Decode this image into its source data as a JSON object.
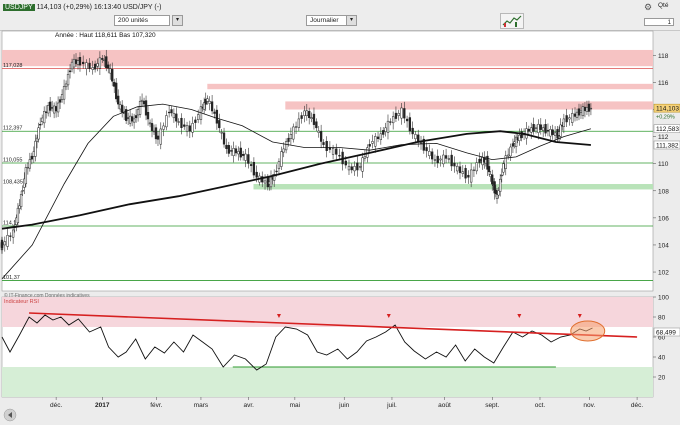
{
  "header": {
    "symbol_badge": "USDJPY",
    "title_suffix": "114,103 (+0,29%) 16:13:40 USD/JPY (-)",
    "units_value": "200 unités",
    "journal_label": "Journalier",
    "qty_label": "Qté",
    "qty_value": "1"
  },
  "chart_data": [
    {
      "type": "line",
      "title": "Année : Haut 118,611 Bas 107,320",
      "source": "© IT-Finance.com Données indicatives",
      "ylim": [
        100.6,
        119.8
      ],
      "y_ticks": [
        102,
        104,
        106,
        108,
        110,
        112,
        114,
        116,
        118
      ],
      "x_tick_labels": [
        "déc.",
        "2017",
        "févr.",
        "mars",
        "avr.",
        "mai",
        "juin",
        "juil.",
        "août",
        "sept.",
        "oct.",
        "nov.",
        "déc."
      ],
      "x_range": [
        "2016-11-01",
        "2017-12-15"
      ],
      "price_labels": [
        "117,028",
        "112,397",
        "110,055",
        "108,435",
        "114,1",
        "101,37"
      ],
      "right_labels": [
        {
          "text": "114,103",
          "kind": "current"
        },
        {
          "text": "+0,29%",
          "kind": "change"
        },
        {
          "text": "112,583",
          "kind": "ma"
        },
        {
          "text": "111,382",
          "kind": "ma"
        }
      ],
      "resistance_zones": [
        {
          "from": 117.2,
          "to": 118.4,
          "start": "2016-11-01"
        },
        {
          "from": 115.5,
          "to": 115.9,
          "start": "2017-03-10"
        },
        {
          "from": 114.0,
          "to": 114.6,
          "start": "2017-04-28"
        }
      ],
      "support_zone": {
        "from": 108.1,
        "to": 108.5,
        "start": "2017-04-08"
      },
      "horizontal_levels": [
        117.028,
        112.397,
        110.055,
        105.4,
        101.37
      ],
      "close_series": [
        [
          "2016-11-01",
          104.0
        ],
        [
          "2016-11-08",
          105.0
        ],
        [
          "2016-11-12",
          107.0
        ],
        [
          "2016-11-16",
          109.5
        ],
        [
          "2016-11-21",
          110.9
        ],
        [
          "2016-11-25",
          113.1
        ],
        [
          "2016-11-30",
          114.2
        ],
        [
          "2016-12-05",
          114.0
        ],
        [
          "2016-12-10",
          115.5
        ],
        [
          "2016-12-15",
          117.5
        ],
        [
          "2016-12-20",
          117.5
        ],
        [
          "2016-12-28",
          117.0
        ],
        [
          "2017-01-03",
          117.8
        ],
        [
          "2017-01-08",
          116.8
        ],
        [
          "2017-01-13",
          114.4
        ],
        [
          "2017-01-18",
          113.4
        ],
        [
          "2017-01-23",
          113.2
        ],
        [
          "2017-01-28",
          114.8
        ],
        [
          "2017-02-02",
          112.8
        ],
        [
          "2017-02-07",
          111.8
        ],
        [
          "2017-02-14",
          114.0
        ],
        [
          "2017-02-20",
          113.0
        ],
        [
          "2017-02-27",
          112.5
        ],
        [
          "2017-03-06",
          114.0
        ],
        [
          "2017-03-10",
          114.8
        ],
        [
          "2017-03-16",
          113.2
        ],
        [
          "2017-03-22",
          111.0
        ],
        [
          "2017-03-28",
          110.9
        ],
        [
          "2017-04-03",
          110.5
        ],
        [
          "2017-04-10",
          109.0
        ],
        [
          "2017-04-17",
          108.5
        ],
        [
          "2017-04-21",
          109.1
        ],
        [
          "2017-04-27",
          111.2
        ],
        [
          "2017-05-03",
          112.5
        ],
        [
          "2017-05-10",
          113.9
        ],
        [
          "2017-05-16",
          113.1
        ],
        [
          "2017-05-22",
          111.3
        ],
        [
          "2017-05-30",
          110.8
        ],
        [
          "2017-06-07",
          109.6
        ],
        [
          "2017-06-14",
          109.8
        ],
        [
          "2017-06-20",
          111.5
        ],
        [
          "2017-06-27",
          112.1
        ],
        [
          "2017-07-03",
          113.2
        ],
        [
          "2017-07-10",
          113.9
        ],
        [
          "2017-07-17",
          112.2
        ],
        [
          "2017-07-24",
          111.2
        ],
        [
          "2017-07-31",
          110.2
        ],
        [
          "2017-08-07",
          110.5
        ],
        [
          "2017-08-14",
          109.6
        ],
        [
          "2017-08-21",
          109.0
        ],
        [
          "2017-08-28",
          110.3
        ],
        [
          "2017-09-01",
          110.2
        ],
        [
          "2017-09-05",
          108.6
        ],
        [
          "2017-09-08",
          107.5
        ],
        [
          "2017-09-12",
          110.0
        ],
        [
          "2017-09-18",
          111.5
        ],
        [
          "2017-09-22",
          112.0
        ],
        [
          "2017-09-28",
          112.5
        ],
        [
          "2017-10-04",
          112.7
        ],
        [
          "2017-10-10",
          112.4
        ],
        [
          "2017-10-16",
          112.1
        ],
        [
          "2017-10-20",
          113.2
        ],
        [
          "2017-10-27",
          113.6
        ],
        [
          "2017-11-01",
          114.0
        ],
        [
          "2017-11-06",
          114.1
        ]
      ],
      "ma_slow": [
        [
          "2016-11-01",
          105.2
        ],
        [
          "2016-11-20",
          105.5
        ],
        [
          "2016-12-20",
          106.2
        ],
        [
          "2017-01-20",
          107.0
        ],
        [
          "2017-02-20",
          107.6
        ],
        [
          "2017-03-20",
          108.3
        ],
        [
          "2017-04-20",
          109.1
        ],
        [
          "2017-05-20",
          110.0
        ],
        [
          "2017-06-20",
          110.8
        ],
        [
          "2017-07-20",
          111.6
        ],
        [
          "2017-08-20",
          112.2
        ],
        [
          "2017-09-10",
          112.4
        ],
        [
          "2017-09-25",
          112.2
        ],
        [
          "2017-10-15",
          111.6
        ],
        [
          "2017-11-06",
          111.38
        ]
      ],
      "ma_fast": [
        [
          "2016-11-01",
          101.5
        ],
        [
          "2016-11-20",
          104.0
        ],
        [
          "2016-12-10",
          108.5
        ],
        [
          "2016-12-25",
          111.5
        ],
        [
          "2017-01-10",
          113.5
        ],
        [
          "2017-01-25",
          114.2
        ],
        [
          "2017-02-10",
          114.4
        ],
        [
          "2017-02-28",
          114.0
        ],
        [
          "2017-03-15",
          113.4
        ],
        [
          "2017-04-01",
          112.8
        ],
        [
          "2017-04-20",
          111.6
        ],
        [
          "2017-05-10",
          111.2
        ],
        [
          "2017-06-01",
          111.2
        ],
        [
          "2017-06-20",
          111.0
        ],
        [
          "2017-07-10",
          111.4
        ],
        [
          "2017-08-01",
          111.5
        ],
        [
          "2017-08-20",
          110.8
        ],
        [
          "2017-09-05",
          110.3
        ],
        [
          "2017-09-20",
          110.5
        ],
        [
          "2017-10-05",
          111.3
        ],
        [
          "2017-10-20",
          112.0
        ],
        [
          "2017-11-06",
          112.58
        ]
      ]
    },
    {
      "type": "line",
      "title": "Indicateur RSI",
      "ylim": [
        0,
        100
      ],
      "y_ticks": [
        20,
        40,
        60,
        80,
        100
      ],
      "current_value": "68,499",
      "overbought_zone": [
        70,
        100
      ],
      "oversold_zone": [
        0,
        30
      ],
      "level_line": 30,
      "trend_line": [
        [
          "2016-11-18",
          84
        ],
        [
          "2017-12-05",
          60
        ]
      ],
      "divergence_markers": [
        "2017-04-24",
        "2017-07-02",
        "2017-09-22",
        "2017-10-30"
      ],
      "series": [
        [
          "2016-11-01",
          60
        ],
        [
          "2016-11-06",
          45
        ],
        [
          "2016-11-12",
          62
        ],
        [
          "2016-11-18",
          80
        ],
        [
          "2016-11-23",
          74
        ],
        [
          "2016-11-28",
          82
        ],
        [
          "2016-12-03",
          77
        ],
        [
          "2016-12-08",
          80
        ],
        [
          "2016-12-13",
          72
        ],
        [
          "2016-12-19",
          78
        ],
        [
          "2016-12-26",
          65
        ],
        [
          "2017-01-02",
          70
        ],
        [
          "2017-01-07",
          50
        ],
        [
          "2017-01-13",
          40
        ],
        [
          "2017-01-18",
          45
        ],
        [
          "2017-01-24",
          58
        ],
        [
          "2017-01-30",
          38
        ],
        [
          "2017-02-05",
          50
        ],
        [
          "2017-02-11",
          44
        ],
        [
          "2017-02-17",
          55
        ],
        [
          "2017-02-23",
          45
        ],
        [
          "2017-03-01",
          62
        ],
        [
          "2017-03-07",
          55
        ],
        [
          "2017-03-13",
          48
        ],
        [
          "2017-03-20",
          30
        ],
        [
          "2017-03-27",
          42
        ],
        [
          "2017-04-03",
          38
        ],
        [
          "2017-04-10",
          27
        ],
        [
          "2017-04-16",
          33
        ],
        [
          "2017-04-22",
          60
        ],
        [
          "2017-04-28",
          70
        ],
        [
          "2017-05-05",
          68
        ],
        [
          "2017-05-12",
          62
        ],
        [
          "2017-05-18",
          45
        ],
        [
          "2017-05-24",
          42
        ],
        [
          "2017-05-31",
          48
        ],
        [
          "2017-06-06",
          38
        ],
        [
          "2017-06-12",
          45
        ],
        [
          "2017-06-18",
          56
        ],
        [
          "2017-06-24",
          60
        ],
        [
          "2017-06-30",
          65
        ],
        [
          "2017-07-06",
          72
        ],
        [
          "2017-07-12",
          55
        ],
        [
          "2017-07-18",
          46
        ],
        [
          "2017-07-25",
          38
        ],
        [
          "2017-08-01",
          45
        ],
        [
          "2017-08-07",
          40
        ],
        [
          "2017-08-13",
          52
        ],
        [
          "2017-08-19",
          36
        ],
        [
          "2017-08-25",
          48
        ],
        [
          "2017-08-31",
          40
        ],
        [
          "2017-09-06",
          34
        ],
        [
          "2017-09-12",
          50
        ],
        [
          "2017-09-18",
          65
        ],
        [
          "2017-09-24",
          60
        ],
        [
          "2017-09-30",
          66
        ],
        [
          "2017-10-06",
          62
        ],
        [
          "2017-10-12",
          55
        ],
        [
          "2017-10-18",
          60
        ],
        [
          "2017-10-24",
          62
        ],
        [
          "2017-10-30",
          68
        ],
        [
          "2017-11-03",
          66
        ],
        [
          "2017-11-07",
          69
        ]
      ]
    }
  ]
}
